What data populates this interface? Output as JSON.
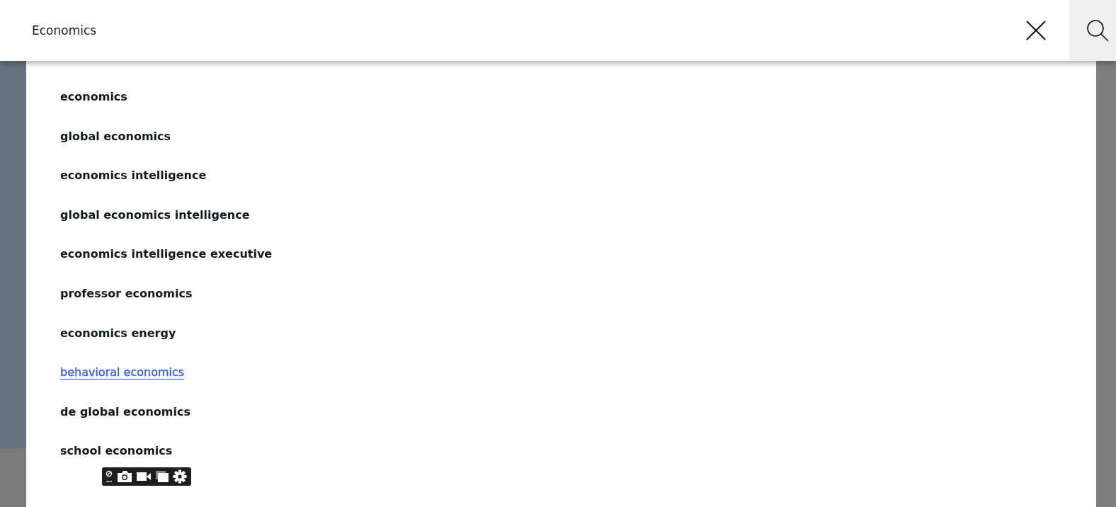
{
  "search": {
    "value": "Economics"
  },
  "suggestions": [
    {
      "label": "economics",
      "selected": false
    },
    {
      "label": "global economics",
      "selected": false
    },
    {
      "label": "economics intelligence",
      "selected": false
    },
    {
      "label": "global economics intelligence",
      "selected": false
    },
    {
      "label": "economics intelligence executive",
      "selected": false
    },
    {
      "label": "professor economics",
      "selected": false
    },
    {
      "label": "economics energy",
      "selected": false
    },
    {
      "label": "behavioral economics",
      "selected": true
    },
    {
      "label": "de global economics",
      "selected": false
    },
    {
      "label": "school economics",
      "selected": false
    }
  ]
}
